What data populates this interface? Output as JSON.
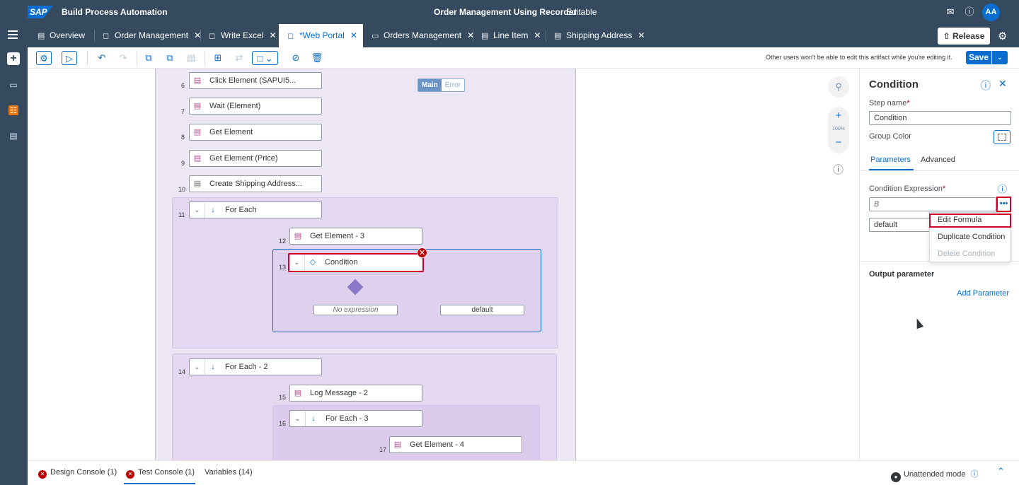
{
  "shell": {
    "logo": "SAP",
    "product": "Build Process Automation",
    "title": "Order Management Using Recorder",
    "state": "Editable",
    "avatar": "AA"
  },
  "tabs": [
    {
      "label": "Overview",
      "icon": "document-icon",
      "closable": false
    },
    {
      "label": "Order Management",
      "icon": "process-icon",
      "closable": true
    },
    {
      "label": "Write Excel",
      "icon": "process-icon",
      "closable": true
    },
    {
      "label": "*Web Portal",
      "icon": "automation-icon",
      "closable": true,
      "active": true
    },
    {
      "label": "Orders Management",
      "icon": "screen-icon",
      "closable": true
    },
    {
      "label": "Line Item",
      "icon": "list-icon",
      "closable": true
    },
    {
      "label": "Shipping Address",
      "icon": "list-icon",
      "closable": true
    }
  ],
  "release_label": "Release",
  "toolbar": {
    "edit_note": "Other users won't be able to edit this artifact while you're editing it.",
    "save_label": "Save"
  },
  "canvas": {
    "segment": {
      "main": "Main",
      "error": "Error"
    },
    "zoom_level": "100%",
    "steps": [
      {
        "num": "6",
        "label": "Click Element (SAPUI5..."
      },
      {
        "num": "7",
        "label": "Wait (Element)"
      },
      {
        "num": "8",
        "label": "Get Element"
      },
      {
        "num": "9",
        "label": "Get Element (Price)"
      },
      {
        "num": "10",
        "label": "Create Shipping Address..."
      },
      {
        "num": "11",
        "label": "For Each"
      },
      {
        "num": "12",
        "label": "Get Element - 3"
      },
      {
        "num": "13",
        "label": "Condition"
      },
      {
        "num": "14",
        "label": "For Each - 2"
      },
      {
        "num": "15",
        "label": "Log Message - 2"
      },
      {
        "num": "16",
        "label": "For Each - 3"
      },
      {
        "num": "17",
        "label": "Get Element - 4"
      }
    ],
    "branches": {
      "no_expression": "No expression",
      "default": "default"
    }
  },
  "panel": {
    "title": "Condition",
    "step_name_label": "Step name",
    "step_name_value": "Condition",
    "group_color_label": "Group Color",
    "tabs": {
      "parameters": "Parameters",
      "advanced": "Advanced"
    },
    "condition_expression_label": "Condition Expression",
    "condition_value": "B",
    "default_value": "default",
    "menu": {
      "edit": "Edit Formula",
      "duplicate": "Duplicate Condition",
      "delete": "Delete Condition"
    },
    "output_parameter_label": "Output parameter",
    "add_parameter": "Add Parameter"
  },
  "bottom": {
    "design_console": "Design Console (1)",
    "test_console": "Test Console (1)",
    "variables": "Variables (14)",
    "mode": "Unattended mode"
  },
  "colors": {
    "shell": "#354a5f",
    "accent": "#0a6ed1",
    "error": "#bb0000",
    "highlight": "#d0002a"
  }
}
